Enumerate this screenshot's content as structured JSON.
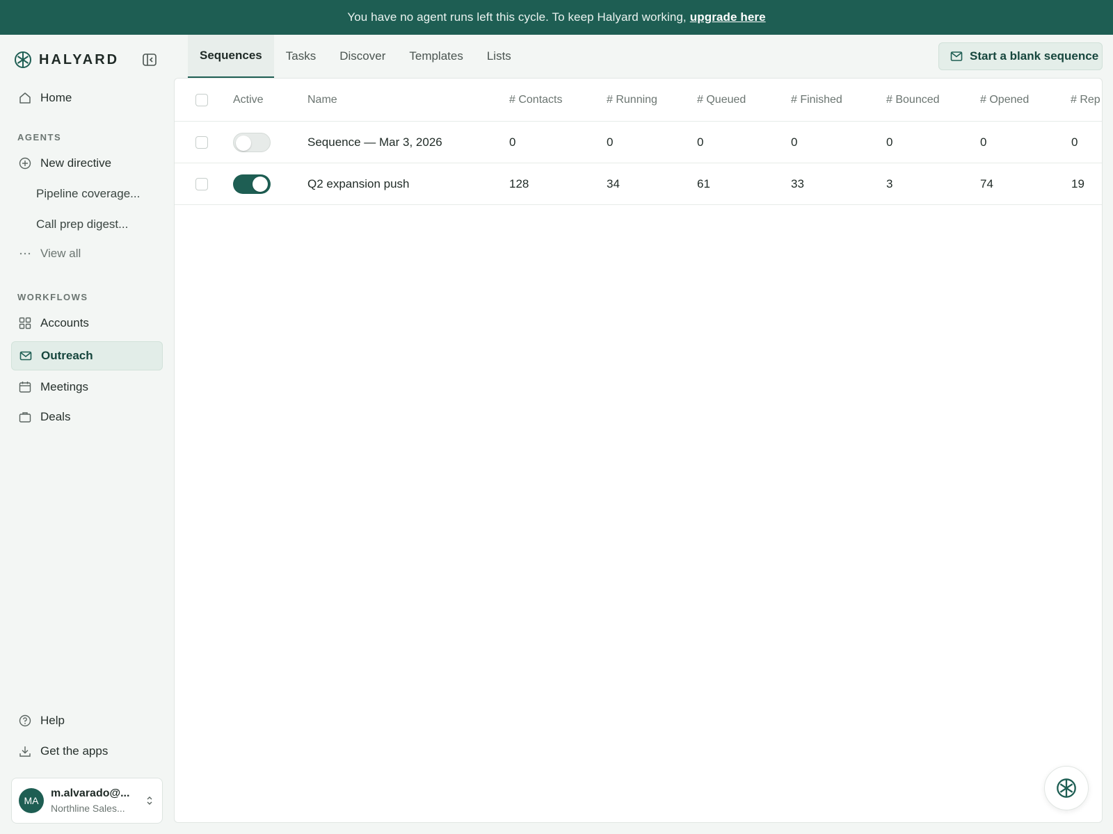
{
  "banner": {
    "message": "You have no agent runs left this cycle. To keep Halyard working,",
    "link": "upgrade here"
  },
  "brand": {
    "name": "HALYARD",
    "icon": "halyard-logo-icon"
  },
  "sidebar": {
    "home": "Home",
    "agents_label": "AGENTS",
    "agents": [
      {
        "label": "New directive",
        "icon": "plus-circle-icon"
      },
      {
        "label": "Pipeline coverage..."
      },
      {
        "label": "Call prep digest..."
      },
      {
        "label": "View all",
        "icon": "more-dots-icon"
      }
    ],
    "workflows_label": "WORKFLOWS",
    "workflows": [
      {
        "label": "Accounts",
        "icon": "grid-icon"
      },
      {
        "label": "Outreach",
        "icon": "mail-icon",
        "active": true
      },
      {
        "label": "Meetings",
        "icon": "calendar-icon"
      },
      {
        "label": "Deals",
        "icon": "briefcase-icon"
      }
    ],
    "help": "Help",
    "get_apps": "Get the apps",
    "account": {
      "initials": "MA",
      "email": "m.alvarado@...",
      "org": "Northline Sales..."
    }
  },
  "tabs": [
    "Sequences",
    "Tasks",
    "Discover",
    "Templates",
    "Lists"
  ],
  "active_tab": "Sequences",
  "start_button": "Start a blank sequence",
  "table": {
    "headers": [
      "Active",
      "Name",
      "# Contacts",
      "# Running",
      "# Queued",
      "# Finished",
      "# Bounced",
      "# Opened",
      "# Rep"
    ],
    "rows": [
      {
        "active": false,
        "name": "Sequence — Mar 3, 2026",
        "contacts": "0",
        "running": "0",
        "queued": "0",
        "finished": "0",
        "bounced": "0",
        "opened": "0",
        "replied": "0"
      },
      {
        "active": true,
        "name": "Q2 expansion push",
        "contacts": "128",
        "running": "34",
        "queued": "61",
        "finished": "33",
        "bounced": "3",
        "opened": "74",
        "replied": "19"
      }
    ]
  },
  "colors": {
    "accent": "#1e5e53",
    "banner_bg": "#1e5e53",
    "active_nav_bg": "#e2ede8"
  }
}
